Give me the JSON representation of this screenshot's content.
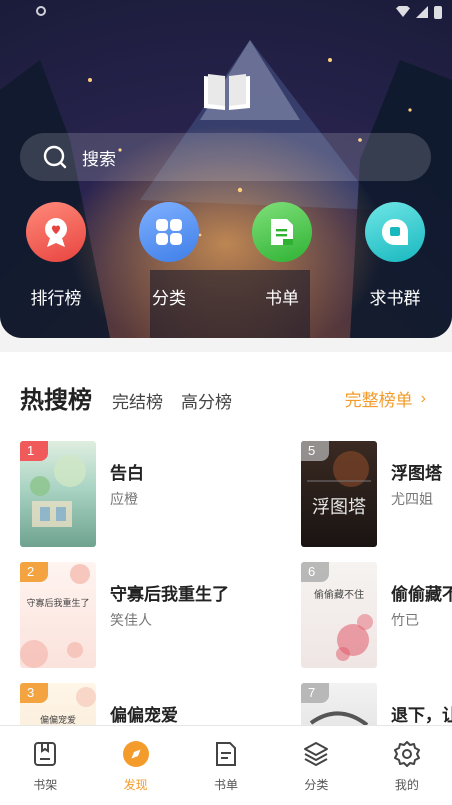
{
  "hero": {
    "search": {
      "placeholder": "搜索"
    },
    "quick_links": [
      {
        "label": "排行榜",
        "icon": "ribbon-heart-icon",
        "color": "#e8443f"
      },
      {
        "label": "分类",
        "icon": "grid-four-icon",
        "color": "#3f7fe8"
      },
      {
        "label": "书单",
        "icon": "booklist-icon",
        "color": "#2fb234"
      },
      {
        "label": "求书群",
        "icon": "chat-bubble-icon",
        "color": "#18b8bf"
      }
    ]
  },
  "ranking": {
    "tabs": [
      {
        "label": "热搜榜",
        "active": true
      },
      {
        "label": "完结榜",
        "active": false
      },
      {
        "label": "高分榜",
        "active": false
      }
    ],
    "full_list_label": "完整榜单",
    "books": [
      {
        "rank": "1",
        "title": "告白",
        "author": "应橙"
      },
      {
        "rank": "5",
        "title": "浮图塔",
        "author": "尤四姐",
        "cover_text": "浮图塔"
      },
      {
        "rank": "2",
        "title": "守寡后我重生了",
        "author": "笑佳人",
        "cover_text": "守寡后我重生了"
      },
      {
        "rank": "6",
        "title": "偷偷藏不",
        "author": "竹已",
        "cover_text": "偷偷藏不住"
      },
      {
        "rank": "3",
        "title": "偏偏宠爱",
        "author": "",
        "cover_text": "偏偏宠爱"
      },
      {
        "rank": "7",
        "title": "退下，让",
        "author": ""
      }
    ]
  },
  "bottom_nav": [
    {
      "label": "书架",
      "icon": "bookshelf-icon",
      "active": false
    },
    {
      "label": "发现",
      "icon": "compass-icon",
      "active": true
    },
    {
      "label": "书单",
      "icon": "booklist-icon",
      "active": false
    },
    {
      "label": "分类",
      "icon": "layers-icon",
      "active": false
    },
    {
      "label": "我的",
      "icon": "gear-icon",
      "active": false
    }
  ],
  "colors": {
    "accent": "#f39c2b",
    "rank_top": "#f05a5a",
    "rank_mid": "#f3a340"
  }
}
